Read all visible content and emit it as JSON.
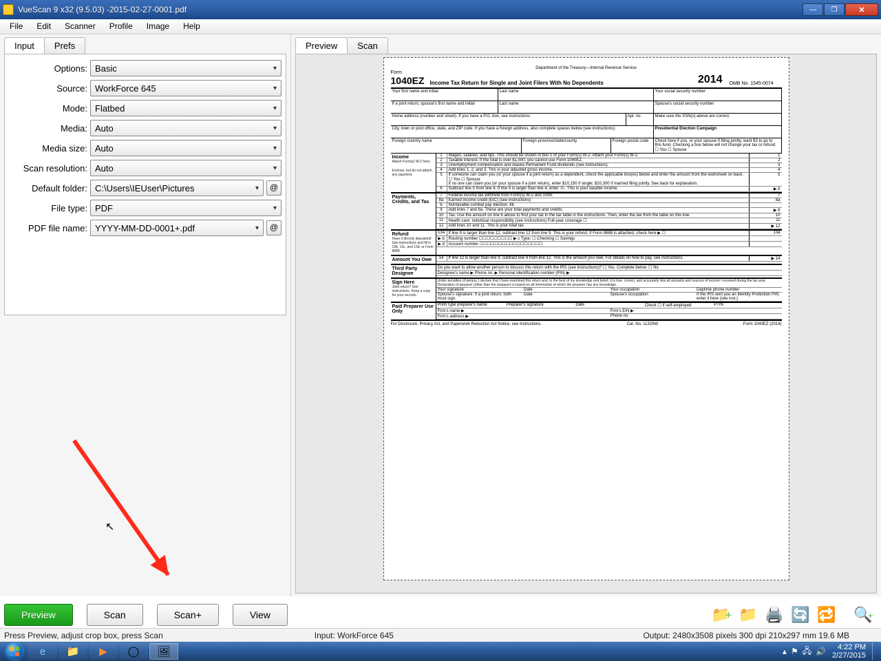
{
  "title": "VueScan 9 x32 (9.5.03) -2015-02-27-0001.pdf",
  "menu": [
    "File",
    "Edit",
    "Scanner",
    "Profile",
    "Image",
    "Help"
  ],
  "leftTabs": {
    "input": "Input",
    "prefs": "Prefs"
  },
  "form": {
    "options": {
      "label": "Options:",
      "value": "Basic"
    },
    "source": {
      "label": "Source:",
      "value": "WorkForce 645"
    },
    "mode": {
      "label": "Mode:",
      "value": "Flatbed"
    },
    "media": {
      "label": "Media:",
      "value": "Auto"
    },
    "mediasize": {
      "label": "Media size:",
      "value": "Auto"
    },
    "scanres": {
      "label": "Scan resolution:",
      "value": "Auto"
    },
    "folder": {
      "label": "Default folder:",
      "value": "C:\\Users\\IEUser\\Pictures"
    },
    "filetype": {
      "label": "File type:",
      "value": "PDF"
    },
    "pdfname": {
      "label": "PDF file name:",
      "value": "YYYY-MM-DD-0001+.pdf"
    }
  },
  "rightTabs": {
    "preview": "Preview",
    "scan": "Scan"
  },
  "bottom": {
    "preview": "Preview",
    "scan": "Scan",
    "scanplus": "Scan+",
    "view": "View"
  },
  "status": {
    "left": "Press Preview, adjust crop box, press Scan",
    "mid": "Input: WorkForce 645",
    "right": "Output: 2480x3508 pixels 300 dpi 210x297 mm 19.6 MB"
  },
  "tray": {
    "time": "4:22 PM",
    "date": "2/27/2015"
  },
  "doc": {
    "formno": "Form",
    "formbig": "1040EZ",
    "dept": "Department of the Treasury—Internal Revenue Service",
    "title": "Income Tax Return for Single and Joint Filers With No Dependents",
    "year": "2014",
    "omb": "OMB No. 1545-0074",
    "fn": "Your first name and initial",
    "ln": "Last name",
    "ssn": "Your social security number",
    "sfn": "If a joint return, spouse's first name and initial",
    "sln": "Last name",
    "sssn": "Spouse's social security number",
    "addr": "Home address (number and street). If you have a P.O. box, see instructions.",
    "apt": "Apt. no.",
    "pec": "Make sure the SSN(s) above are correct.",
    "city": "City, town or post office, state, and ZIP code. If you have a foreign address, also complete spaces below (see instructions).",
    "pecamp": "Presidential Election Campaign",
    "fcn": "Foreign country name",
    "fps": "Foreign province/state/county",
    "fpc": "Foreign postal code",
    "pectext": "Check here if you, or your spouse if filing jointly, want $3 to go to this fund. Checking a box below will not change your tax or refund.",
    "youspouse": "☐ You  ☐ Spouse",
    "sec_income": "Income",
    "inc_sub": "Attach Form(s) W-2 here.",
    "inc_sub2": "Enclose, but do not attach, any payment.",
    "l1": "Wages, salaries, and tips. This should be shown in box 1 of your Form(s) W-2. Attach your Form(s) W-2.",
    "l2": "Taxable interest. If the total is over $1,500, you cannot use Form 1040EZ.",
    "l3": "Unemployment compensation and Alaska Permanent Fund dividends (see instructions).",
    "l4": "Add lines 1, 2, and 3. This is your adjusted gross income.",
    "l5": "If someone can claim you (or your spouse if a joint return) as a dependent, check the applicable box(es) below and enter the amount from the worksheet on back.",
    "l5b": "☐ You   ☐ Spouse",
    "l5c": "If no one can claim you (or your spouse if a joint return), enter $10,150 if single; $20,300 if married filing jointly. See back for explanation.",
    "l6": "Subtract line 5 from line 4. If line 5 is larger than line 4, enter -0-. This is your taxable income.",
    "sec_pay": "Payments, Credits, and Tax",
    "l7": "Federal income tax withheld from Form(s) W-2 and 1099.",
    "l8a": "Earned income credit (EIC) (see instructions)",
    "l8b": "Nontaxable combat pay election.",
    "l9": "Add lines 7 and 8a. These are your total payments and credits.",
    "l10": "Tax. Use the amount on line 6 above to find your tax in the tax table in the instructions. Then, enter the tax from the table on this line.",
    "l11": "Health care: individual responsibility (see instructions)   Full-year coverage ☐",
    "l12": "Add lines 10 and 11. This is your total tax.",
    "sec_refund": "Refund",
    "ref_sub": "Have it directly deposited! See instructions and fill in 13b, 13c, and 13d, or Form 8888.",
    "l13a": "If line 9 is larger than line 12, subtract line 12 from line 9. This is your refund. If Form 8888 is attached, check here ▶ ☐",
    "l13b": "Routing number",
    "l13c": "▶ c Type: ☐ Checking ☐ Savings",
    "l13d": "Account number",
    "sec_owe": "Amount You Owe",
    "l14": "If line 12 is larger than line 9, subtract line 9 from line 12. This is the amount you owe. For details on how to pay, see instructions.",
    "sec_tp": "Third Party Designee",
    "tp": "Do you want to allow another person to discuss this return with the IRS (see instructions)?   ☐ Yes. Complete below.  ☐ No",
    "tp2": "Designee's name ▶        Phone no. ▶        Personal identification number (PIN) ▶",
    "sec_sign": "Sign Here",
    "sign_sub": "Joint return? See instructions. Keep a copy for your records.",
    "sig1": "Under penalties of perjury, I declare that I have examined this return and, to the best of my knowledge and belief, it is true, correct, and accurately lists all amounts and sources of income I received during the tax year. Declaration of preparer (other than the taxpayer) is based on all information of which the preparer has any knowledge.",
    "sig2": "Your signature",
    "sig3": "Date",
    "sig4": "Your occupation",
    "sig5": "Daytime phone number",
    "sig6": "Spouse's signature. If a joint return, both must sign.",
    "sig7": "Date",
    "sig8": "Spouse's occupation",
    "sig9": "If the IRS sent you an Identity Protection PIN, enter it here (see inst.)",
    "sec_prep": "Paid Preparer Use Only",
    "p1": "Print/Type preparer's name",
    "p2": "Preparer's signature",
    "p3": "Date",
    "p4": "Check ☐ if self-employed",
    "p5": "PTIN",
    "p6": "Firm's name ▶",
    "p7": "Firm's EIN ▶",
    "p8": "Firm's address ▶",
    "p9": "Phone no.",
    "foot": "For Disclosure, Privacy Act, and Paperwork Reduction Act Notice, see instructions.",
    "cat": "Cat. No. 11329W",
    "formend": "Form 1040EZ (2014)"
  }
}
